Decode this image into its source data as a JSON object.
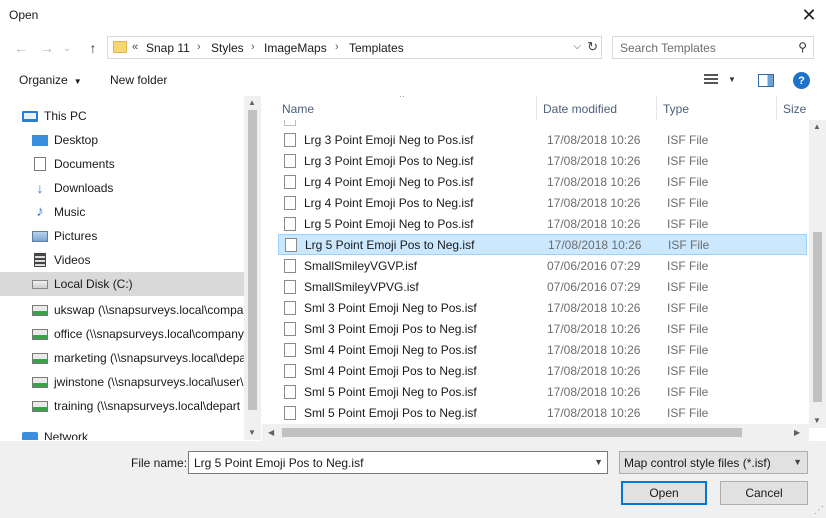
{
  "window": {
    "title": "Open"
  },
  "nav": {
    "back_icon": "←",
    "forward_icon": "→",
    "recent_icon": "⌄",
    "up_icon": "↑",
    "overflow": "«",
    "breadcrumbs": [
      "Snap 11",
      "Styles",
      "ImageMaps",
      "Templates"
    ],
    "search_placeholder": "Search Templates"
  },
  "toolbar": {
    "organize": "Organize",
    "new_folder": "New folder",
    "help": "?"
  },
  "sidebar": {
    "items": [
      {
        "label": "This PC",
        "icon": "pc"
      },
      {
        "label": "Desktop",
        "icon": "desktop"
      },
      {
        "label": "Documents",
        "icon": "docs"
      },
      {
        "label": "Downloads",
        "icon": "downloads"
      },
      {
        "label": "Music",
        "icon": "music"
      },
      {
        "label": "Pictures",
        "icon": "pictures"
      },
      {
        "label": "Videos",
        "icon": "videos"
      },
      {
        "label": "Local Disk (C:)",
        "icon": "disk"
      },
      {
        "label": "ukswap (\\\\snapsurveys.local\\compa",
        "icon": "netdrive"
      },
      {
        "label": "office (\\\\snapsurveys.local\\company",
        "icon": "netdrive"
      },
      {
        "label": "marketing (\\\\snapsurveys.local\\depa",
        "icon": "netdrive"
      },
      {
        "label": "jwinstone (\\\\snapsurveys.local\\user\\",
        "icon": "netdrive"
      },
      {
        "label": "training (\\\\snapsurveys.local\\depart",
        "icon": "netdrive"
      },
      {
        "label": "Network",
        "icon": "network"
      }
    ],
    "selected_index": 7
  },
  "columns": {
    "name": "Name",
    "date": "Date modified",
    "type": "Type",
    "size": "Size"
  },
  "files": [
    {
      "name": "Lrg 3 Point Emoji Neg to Pos.isf",
      "date": "17/08/2018 10:26",
      "type": "ISF File"
    },
    {
      "name": "Lrg 3 Point Emoji Pos to Neg.isf",
      "date": "17/08/2018 10:26",
      "type": "ISF File"
    },
    {
      "name": "Lrg 4 Point Emoji Neg to Pos.isf",
      "date": "17/08/2018 10:26",
      "type": "ISF File"
    },
    {
      "name": "Lrg 4 Point Emoji Pos to Neg.isf",
      "date": "17/08/2018 10:26",
      "type": "ISF File"
    },
    {
      "name": "Lrg 5 Point Emoji Neg to Pos.isf",
      "date": "17/08/2018 10:26",
      "type": "ISF File"
    },
    {
      "name": "Lrg 5 Point Emoji Pos to Neg.isf",
      "date": "17/08/2018 10:26",
      "type": "ISF File"
    },
    {
      "name": "SmallSmileyVGVP.isf",
      "date": "07/06/2016 07:29",
      "type": "ISF File"
    },
    {
      "name": "SmallSmileyVPVG.isf",
      "date": "07/06/2016 07:29",
      "type": "ISF File"
    },
    {
      "name": "Sml 3 Point Emoji Neg to Pos.isf",
      "date": "17/08/2018 10:26",
      "type": "ISF File"
    },
    {
      "name": "Sml 3 Point Emoji Pos to Neg.isf",
      "date": "17/08/2018 10:26",
      "type": "ISF File"
    },
    {
      "name": "Sml 4 Point Emoji Neg to Pos.isf",
      "date": "17/08/2018 10:26",
      "type": "ISF File"
    },
    {
      "name": "Sml 4 Point Emoji Pos to Neg.isf",
      "date": "17/08/2018 10:26",
      "type": "ISF File"
    },
    {
      "name": "Sml 5 Point Emoji Neg to Pos.isf",
      "date": "17/08/2018 10:26",
      "type": "ISF File"
    },
    {
      "name": "Sml 5 Point Emoji Pos to Neg.isf",
      "date": "17/08/2018 10:26",
      "type": "ISF File"
    }
  ],
  "selected_file_index": 5,
  "footer": {
    "file_name_label": "File name:",
    "file_name_value": "Lrg 5 Point Emoji Pos to Neg.isf",
    "filter_value": "Map control style files (*.isf)",
    "open_label": "Open",
    "cancel_label": "Cancel"
  },
  "colors": {
    "selection": "#cce8ff",
    "selection_border": "#99d1ff",
    "accent": "#0078d7"
  }
}
